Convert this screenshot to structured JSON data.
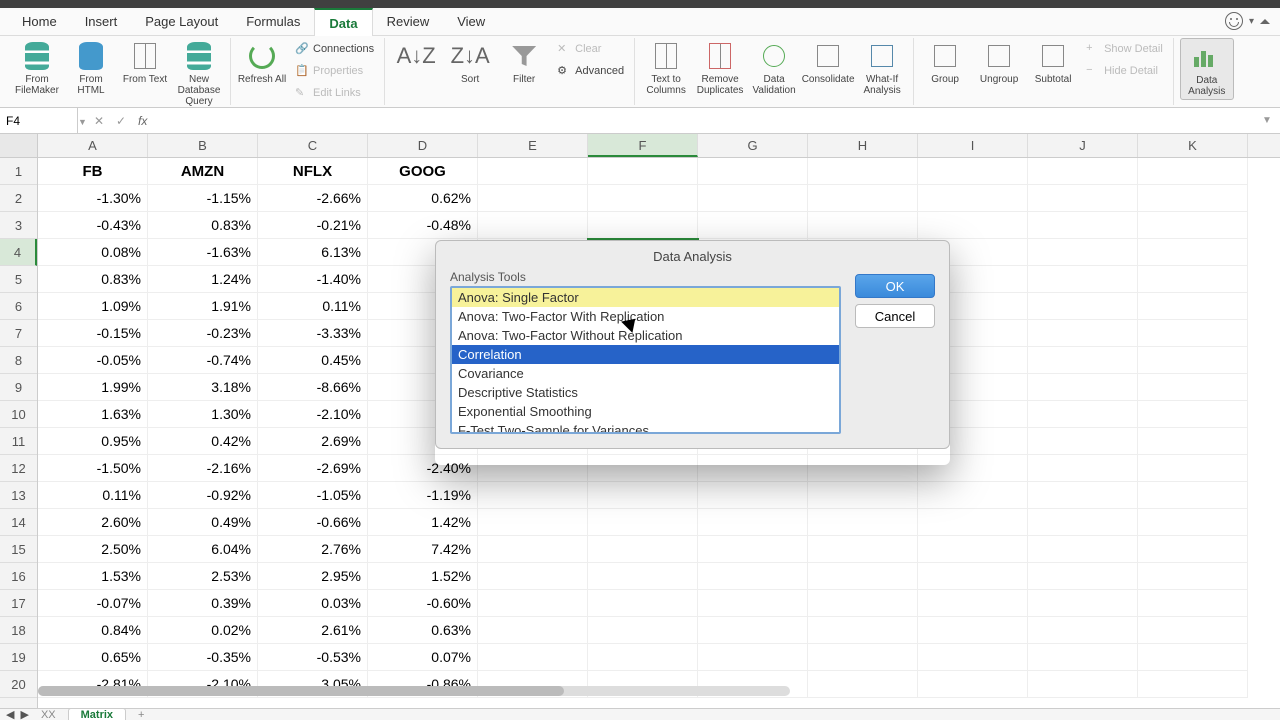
{
  "menu": {
    "tabs": [
      "Home",
      "Insert",
      "Page Layout",
      "Formulas",
      "Data",
      "Review",
      "View"
    ],
    "active_index": 4
  },
  "ribbon": {
    "external": {
      "from_filemaker": "From FileMaker",
      "from_html": "From HTML",
      "from_text": "From Text",
      "new_db_query": "New Database Query",
      "refresh_all": "Refresh All"
    },
    "connections": {
      "connections": "Connections",
      "properties": "Properties",
      "edit_links": "Edit Links"
    },
    "sort_filter": {
      "sort": "Sort",
      "filter": "Filter",
      "clear": "Clear",
      "advanced": "Advanced"
    },
    "data_tools": {
      "text_to_columns": "Text to Columns",
      "remove_duplicates": "Remove Duplicates",
      "data_validation": "Data Validation",
      "consolidate": "Consolidate",
      "what_if": "What-If Analysis"
    },
    "outline": {
      "group": "Group",
      "ungroup": "Ungroup",
      "subtotal": "Subtotal",
      "show_detail": "Show Detail",
      "hide_detail": "Hide Detail"
    },
    "analysis": {
      "data_analysis": "Data Analysis"
    }
  },
  "formula_bar": {
    "name_box": "F4",
    "fx": "fx",
    "formula": ""
  },
  "grid": {
    "columns": [
      "A",
      "B",
      "C",
      "D",
      "E",
      "F",
      "G",
      "H",
      "I",
      "J",
      "K"
    ],
    "active_col_index": 5,
    "rows": 20,
    "active_row": 4,
    "headers": [
      "FB",
      "AMZN",
      "NFLX",
      "GOOG"
    ],
    "data": [
      [
        "-1.30%",
        "-1.15%",
        "-2.66%",
        "0.62%"
      ],
      [
        "-0.43%",
        "0.83%",
        "-0.21%",
        "-0.48%"
      ],
      [
        "0.08%",
        "-1.63%",
        "6.13%",
        ""
      ],
      [
        "0.83%",
        "1.24%",
        "-1.40%",
        ""
      ],
      [
        "1.09%",
        "1.91%",
        "0.11%",
        ""
      ],
      [
        "-0.15%",
        "-0.23%",
        "-3.33%",
        ""
      ],
      [
        "-0.05%",
        "-0.74%",
        "0.45%",
        ""
      ],
      [
        "1.99%",
        "3.18%",
        "-8.66%",
        ""
      ],
      [
        "1.63%",
        "1.30%",
        "-2.10%",
        ""
      ],
      [
        "0.95%",
        "0.42%",
        "2.69%",
        ""
      ],
      [
        "-1.50%",
        "-2.16%",
        "-2.69%",
        "-2.40%"
      ],
      [
        "0.11%",
        "-0.92%",
        "-1.05%",
        "-1.19%"
      ],
      [
        "2.60%",
        "0.49%",
        "-0.66%",
        "1.42%"
      ],
      [
        "2.50%",
        "6.04%",
        "2.76%",
        "7.42%"
      ],
      [
        "1.53%",
        "2.53%",
        "2.95%",
        "1.52%"
      ],
      [
        "-0.07%",
        "0.39%",
        "0.03%",
        "-0.60%"
      ],
      [
        "0.84%",
        "0.02%",
        "2.61%",
        "0.63%"
      ],
      [
        "0.65%",
        "-0.35%",
        "-0.53%",
        "0.07%"
      ],
      [
        "-2.81%",
        "-2.10%",
        "3.05%",
        "-0.86%"
      ]
    ]
  },
  "dialog": {
    "title": "Data Analysis",
    "tools_label": "Analysis Tools",
    "tools": [
      "Anova: Single Factor",
      "Anova: Two-Factor With Replication",
      "Anova: Two-Factor Without Replication",
      "Correlation",
      "Covariance",
      "Descriptive Statistics",
      "Exponential Smoothing",
      "F-Test Two-Sample for Variances"
    ],
    "selected_index": 3,
    "hover_index": 0,
    "ok": "OK",
    "cancel": "Cancel"
  },
  "sheets": {
    "tabs": [
      "XX",
      "Matrix"
    ],
    "active_index": 1,
    "add": "+"
  }
}
